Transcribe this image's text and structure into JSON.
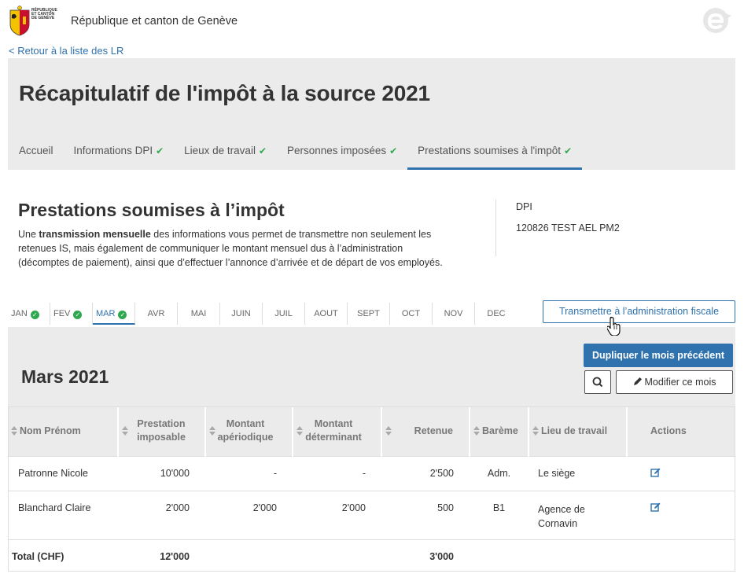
{
  "header": {
    "logo_text": [
      "RÉPUBLIQUE",
      "ET CANTON",
      "DE GENÈVE"
    ],
    "site_title": "République et canton de Genève",
    "back_link": "< Retour à la liste des LR"
  },
  "banner": {
    "title": "Récapitulatif de l'impôt à la source 2021",
    "tabs": [
      {
        "label": "Accueil",
        "check": ""
      },
      {
        "label": "Informations DPI",
        "check": "✔"
      },
      {
        "label": "Lieux de travail",
        "check": "✔"
      },
      {
        "label": "Personnes imposées",
        "check": "✔"
      },
      {
        "label": "Prestations soumises à l'impôt",
        "check": "✔"
      }
    ]
  },
  "section": {
    "title": "Prestations soumises à l’impôt",
    "desc_prefix": "Une ",
    "desc_bold": "transmission mensuelle",
    "desc_rest": " des informations vous permet de transmettre non seulement les retenues IS, mais également de communiquer le montant mensuel dus à l’administration (décomptes de paiement), ainsi que d’effectuer l’annonce d’arrivée et de départ de vos employés.",
    "dpi_label": "DPI",
    "dpi_value": "120826 TEST AEL PM2"
  },
  "months": [
    {
      "label": "JAN",
      "done": true
    },
    {
      "label": "FEV",
      "done": true
    },
    {
      "label": "MAR",
      "done": true,
      "active": true
    },
    {
      "label": "AVR"
    },
    {
      "label": "MAI"
    },
    {
      "label": "JUIN"
    },
    {
      "label": "JUIL"
    },
    {
      "label": "AOUT"
    },
    {
      "label": "SEPT"
    },
    {
      "label": "OCT"
    },
    {
      "label": "NOV"
    },
    {
      "label": "DEC"
    }
  ],
  "actions": {
    "transmit": "Transmettre à l’administration fiscale",
    "duplicate": "Dupliquer le mois précédent",
    "edit": "Modifier ce mois"
  },
  "panel": {
    "month_title": "Mars 2021"
  },
  "table": {
    "headers": [
      "Nom Prénom",
      "Prestation imposable",
      "Montant apériodique",
      "Montant déterminant",
      "Retenue",
      "Barème",
      "Lieu de travail",
      "Actions"
    ],
    "rows": [
      {
        "name": "Patronne Nicole",
        "prestation": "10'000",
        "aperiodique": "-",
        "determinant": "-",
        "retenue": "2'500",
        "bareme": "Adm.",
        "lieu": "Le siège"
      },
      {
        "name": "Blanchard Claire",
        "prestation": "2'000",
        "aperiodique": "2'000",
        "determinant": "2'000",
        "retenue": "500",
        "bareme": "B1",
        "lieu": "Agence de Cornavin"
      }
    ],
    "total": {
      "label": "Total (CHF)",
      "prestation": "12'000",
      "retenue": "3'000"
    }
  },
  "colors": {
    "accent": "#2f72ad",
    "check": "#2fa84f",
    "grey": "#ebebeb"
  }
}
